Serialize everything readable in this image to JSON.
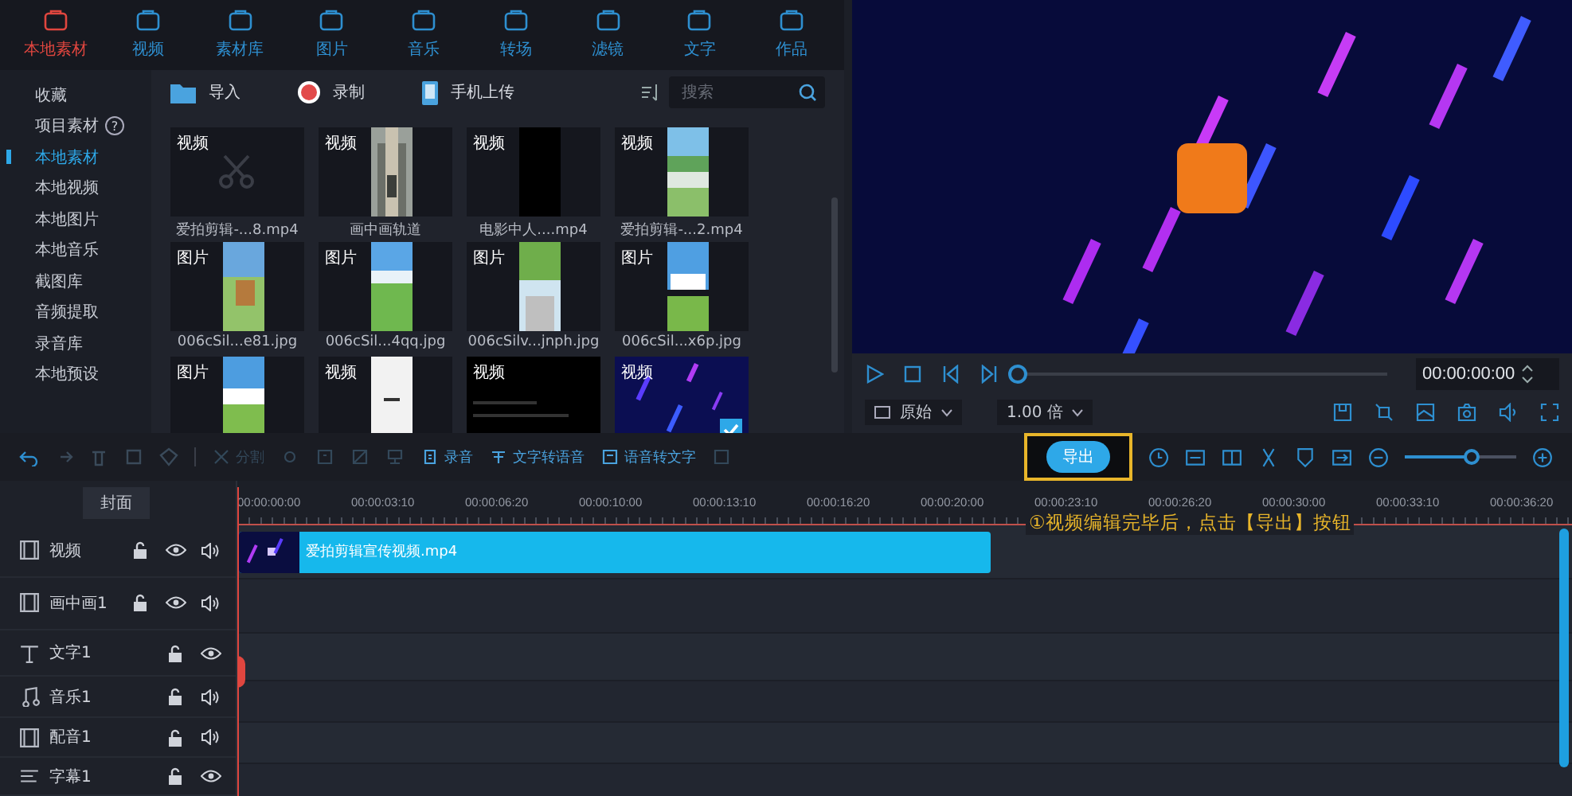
{
  "nav": [
    {
      "label": "本地素材",
      "selected": true
    },
    {
      "label": "视频",
      "selected": false
    },
    {
      "label": "素材库",
      "selected": false
    },
    {
      "label": "图片",
      "selected": false
    },
    {
      "label": "音乐",
      "selected": false
    },
    {
      "label": "转场",
      "selected": false
    },
    {
      "label": "滤镜",
      "selected": false
    },
    {
      "label": "文字",
      "selected": false
    },
    {
      "label": "作品",
      "selected": false
    }
  ],
  "sidebar": {
    "items": [
      {
        "label": "收藏",
        "selected": false
      },
      {
        "label": "项目素材",
        "selected": false,
        "help": "?"
      },
      {
        "label": "本地素材",
        "selected": true
      },
      {
        "label": "本地视频",
        "selected": false
      },
      {
        "label": "本地图片",
        "selected": false
      },
      {
        "label": "本地音乐",
        "selected": false
      },
      {
        "label": "截图库",
        "selected": false
      },
      {
        "label": "音频提取",
        "selected": false
      },
      {
        "label": "录音库",
        "selected": false
      },
      {
        "label": "本地预设",
        "selected": false
      }
    ]
  },
  "library_toolbar": {
    "buttons": [
      "导入",
      "录制",
      "手机上传"
    ],
    "search": {
      "placeholder": "搜索"
    }
  },
  "media": [
    {
      "badge": "视频",
      "caption": "爱拍剪辑-...8.mp4",
      "kind": "placeholder",
      "selected": false
    },
    {
      "badge": "视频",
      "caption": "画中画轨道",
      "kind": "picture",
      "selected": false
    },
    {
      "badge": "视频",
      "caption": "电影中人....mp4",
      "kind": "picture",
      "selected": false
    },
    {
      "badge": "视频",
      "caption": "爱拍剪辑-...2.mp4",
      "kind": "picture",
      "selected": false
    },
    {
      "badge": "图片",
      "caption": "006cSil...e81.jpg",
      "kind": "picture",
      "selected": false
    },
    {
      "badge": "图片",
      "caption": "006cSil...4qq.jpg",
      "kind": "picture",
      "selected": false
    },
    {
      "badge": "图片",
      "caption": "006cSilv...jnph.jpg",
      "kind": "picture",
      "selected": false
    },
    {
      "badge": "图片",
      "caption": "006cSil...x6p.jpg",
      "kind": "picture",
      "selected": false
    },
    {
      "badge": "图片",
      "kind": "picture",
      "selected": false
    },
    {
      "badge": "视频",
      "kind": "picture",
      "selected": false
    },
    {
      "badge": "视频",
      "kind": "picture",
      "selected": false
    },
    {
      "badge": "视频",
      "kind": "picture",
      "selected": true
    }
  ],
  "preview": {
    "progress": {
      "level": 0
    },
    "time": "00:00:00:00",
    "ratio": "原始",
    "speed": "1.00 倍"
  },
  "edit_toolbar": {
    "tools": [
      {
        "label": "分割",
        "disabled": true
      },
      {
        "disabled": true
      },
      {
        "disabled": true
      },
      {
        "disabled": true
      },
      {
        "disabled": true
      },
      {
        "label": "录音",
        "disabled": false
      },
      {
        "label": "文字转语音",
        "disabled": false
      },
      {
        "label": "语音转文字",
        "disabled": false
      },
      {
        "disabled": true
      }
    ],
    "export": {
      "label": "导出",
      "highlighted": true
    },
    "zoom": {
      "level": 0.6
    }
  },
  "timeline": {
    "cover": "封面",
    "ticks": [
      "00:00:00:00",
      "00:00:03:10",
      "00:00:06:20",
      "00:00:10:00",
      "00:00:13:10",
      "00:00:16:20",
      "00:00:20:00",
      "00:00:23:10",
      "00:00:26:20",
      "00:00:30:00",
      "00:00:33:10",
      "00:00:36:20"
    ],
    "annotation": "①视频编辑完毕后，点击【导出】按钮",
    "tracks": [
      {
        "name": "视频",
        "kind": "video",
        "clip": "爱拍剪辑宣传视频.mp4"
      },
      {
        "name": "画中画1",
        "kind": "pip"
      },
      {
        "name": "文字1",
        "kind": "text"
      },
      {
        "name": "音乐1",
        "kind": "music"
      },
      {
        "name": "配音1",
        "kind": "voice"
      },
      {
        "name": "字幕1",
        "kind": "subtitle"
      }
    ]
  }
}
